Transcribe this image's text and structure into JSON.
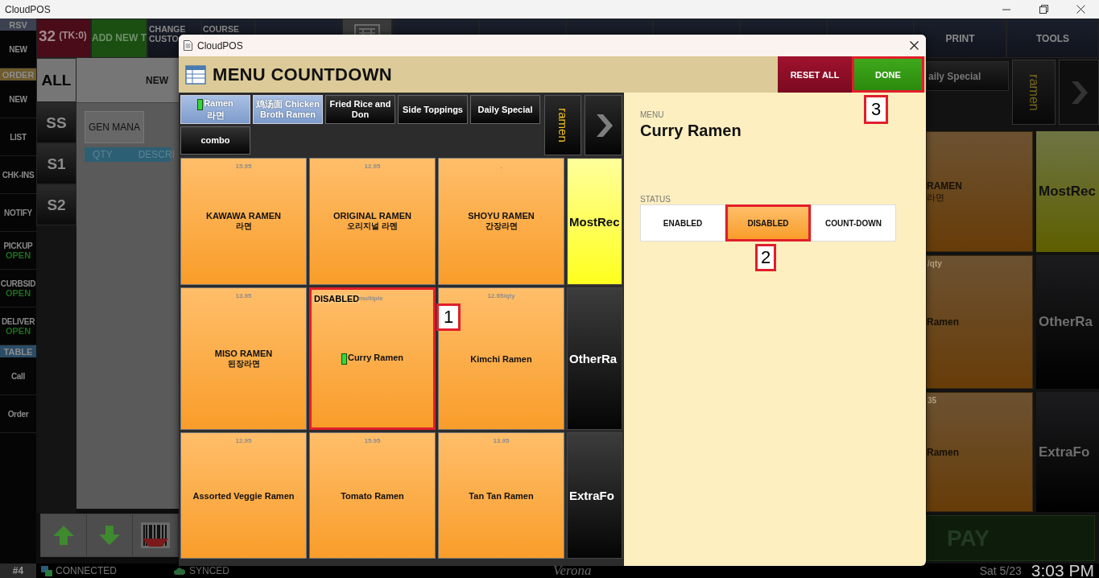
{
  "app_title": "CloudPOS",
  "nav": [
    {
      "kind": "header",
      "label": "RSV",
      "color": "#3b4150"
    },
    {
      "kind": "item",
      "label": "NEW"
    },
    {
      "kind": "header",
      "label": "ORDER",
      "color": "#6e5a2c"
    },
    {
      "kind": "item",
      "label": "NEW"
    },
    {
      "kind": "item",
      "label": "LIST"
    },
    {
      "kind": "item",
      "label": "CHK-INS"
    },
    {
      "kind": "item",
      "label": "NOTIFY"
    },
    {
      "kind": "item",
      "label": "PICKUP",
      "status": "OPEN"
    },
    {
      "kind": "item",
      "label": "CURBSID",
      "status": "OPEN"
    },
    {
      "kind": "item",
      "label": "DELIVER",
      "status": "OPEN"
    },
    {
      "kind": "header",
      "label": "TABLE",
      "color": "#2b4c66"
    },
    {
      "kind": "item",
      "label": "Call"
    },
    {
      "kind": "item",
      "label": "Order"
    }
  ],
  "topbar": [
    {
      "kind": "ticket",
      "label": "32",
      "sub": "(TK:0)"
    },
    {
      "kind": "add",
      "label": "ADD NEW T"
    },
    {
      "kind": "plain",
      "label": "CHANGE CUSTO"
    },
    {
      "kind": "plain",
      "label": "COURSE"
    },
    {
      "kind": "blank"
    },
    {
      "kind": "icon"
    },
    {
      "kind": "blank"
    },
    {
      "kind": "blank"
    },
    {
      "kind": "blank"
    },
    {
      "kind": "blank"
    },
    {
      "kind": "blank"
    },
    {
      "kind": "blank"
    },
    {
      "kind": "plain",
      "label": "PRINT"
    },
    {
      "kind": "plain",
      "label": "TOOLS"
    }
  ],
  "seats": [
    {
      "label": "ALL",
      "selected": true
    },
    {
      "label": "SS",
      "selected": false
    },
    {
      "label": "S1",
      "selected": false
    },
    {
      "label": "S2",
      "selected": false
    }
  ],
  "order": {
    "header": "NEW",
    "manager_button": "GEN MANA",
    "columns": [
      "QTY",
      "DESCRI"
    ]
  },
  "background_menu": {
    "category": "aily Special",
    "group_tab": "ramen",
    "tiles": [
      {
        "name": "RAMEN",
        "sub": "라면"
      },
      {
        "price": "/qty",
        "name": "Ramen"
      },
      {
        "price": "35",
        "name": "Ramen"
      }
    ],
    "groups": [
      {
        "label": "MostRec",
        "kind": "highlight"
      },
      {
        "label": "OtherRa",
        "kind": "dark"
      },
      {
        "label": "ExtraFo",
        "kind": "dark"
      }
    ],
    "pay": "PAY"
  },
  "dialog": {
    "title": "CloudPOS",
    "heading": "MENU COUNTDOWN",
    "reset_button": "RESET ALL",
    "done_button": {
      "label": "DONE",
      "callout": "3"
    },
    "categories": [
      {
        "label": "Ramen",
        "sub": "라면",
        "selected": true,
        "marked": true
      },
      {
        "label": "鸡汤面 Chicken Broth Ramen",
        "selected": true,
        "marked": false
      },
      {
        "label": "Fried Rice and Don",
        "selected": false,
        "marked": false
      },
      {
        "label": "Side Toppings",
        "selected": false,
        "marked": false
      },
      {
        "label": "Daily Special",
        "selected": false,
        "marked": false
      },
      {
        "label": "combo",
        "selected": false,
        "marked": false
      }
    ],
    "group_tab": "ramen",
    "items": [
      {
        "price": "15.95",
        "name": "KAWAWA RAMEN",
        "sub": "라면",
        "marked": false
      },
      {
        "price": "12.95",
        "name": "ORIGINAL RAMEN",
        "sub": "오리지널 라멘",
        "marked": false
      },
      {
        "price": ".",
        "name": "SHOYU RAMEN",
        "sub": "간장라면",
        "marked": false
      },
      {
        "price": "13.95",
        "name": "MISO RAMEN",
        "sub": "된장라면",
        "marked": false
      },
      {
        "price": "multiple",
        "name": "Curry Ramen",
        "status": "DISABLED",
        "marked": true,
        "callout": "1"
      },
      {
        "price": "12.95/qty",
        "name": "Kimchi Ramen",
        "marked": false
      },
      {
        "price": "12.95",
        "name": "Assorted Veggie Ramen",
        "marked": false
      },
      {
        "price": "15.95",
        "name": "Tomato Ramen",
        "marked": false
      },
      {
        "price": "13.95",
        "name": "Tan Tan Ramen",
        "marked": false
      }
    ],
    "groups": [
      {
        "label": "MostRec",
        "kind": "highlight"
      },
      {
        "label": "OtherRa",
        "kind": "dark"
      },
      {
        "label": "ExtraFo",
        "kind": "dark"
      }
    ],
    "detail": {
      "menu_label": "MENU",
      "item_name": "Curry Ramen",
      "status_label": "STATUS",
      "options": [
        {
          "label": "ENABLED",
          "selected": false
        },
        {
          "label": "DISABLED",
          "selected": true,
          "callout": "2"
        },
        {
          "label": "COUNT-DOWN",
          "selected": false
        }
      ]
    }
  },
  "status_bar": {
    "station": "#4",
    "connection": "CONNECTED",
    "sync": "SYNCED",
    "location": "Verona",
    "date": "Sat 5/23",
    "time": "3:03 PM"
  }
}
